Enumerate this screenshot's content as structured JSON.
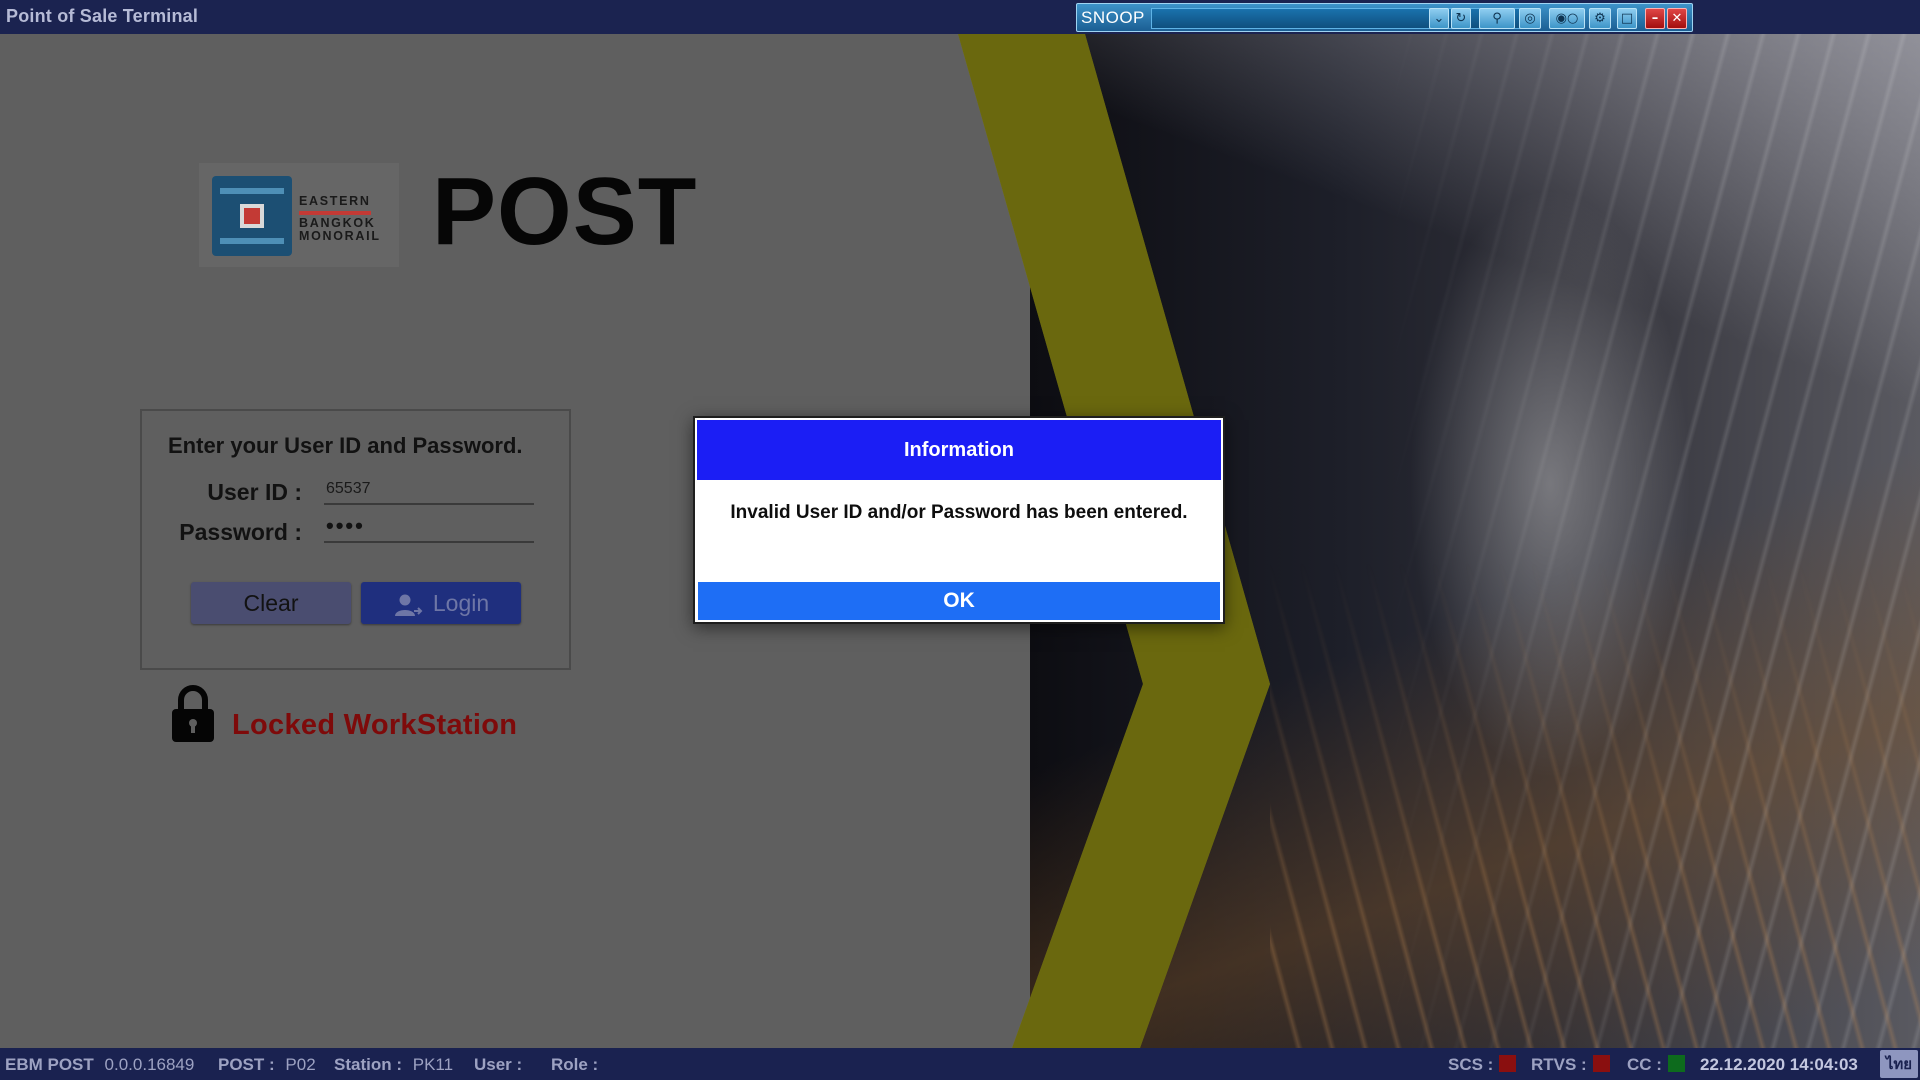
{
  "window": {
    "title": "Point of Sale Terminal"
  },
  "snoop": {
    "label": "SNOOP",
    "buttons": [
      "dropdown",
      "refresh",
      "search",
      "target",
      "toggle",
      "settings",
      "window",
      "minimize",
      "close"
    ]
  },
  "branding": {
    "logo_lines": [
      "EASTERN",
      "BANGKOK",
      "MONORAIL"
    ],
    "title": "POST",
    "colors": {
      "brand_blue": "#1c4f73",
      "brand_red": "#c33a35"
    }
  },
  "login": {
    "prompt": "Enter your User ID and Password.",
    "user_id_label": "User ID :",
    "user_id_value": "65537",
    "password_label": "Password :",
    "password_mask": "••••",
    "clear_label": "Clear",
    "login_label": "Login",
    "locked_label": "Locked WorkStation"
  },
  "dialog": {
    "title": "Information",
    "message": "Invalid User ID and/or Password has been entered.",
    "ok_label": "OK",
    "colors": {
      "header": "#1b1ef5",
      "ok_button": "#1e6ef5"
    }
  },
  "status": {
    "app_name": "EBM POST",
    "version": "0.0.0.16849",
    "post_label": "POST :",
    "post_value": "P02",
    "station_label": "Station :",
    "station_value": "PK11",
    "user_label": "User :",
    "user_value": "",
    "role_label": "Role :",
    "role_value": "",
    "scs_label": "SCS :",
    "scs_color": "#8a0f0f",
    "rtvs_label": "RTVS :",
    "rtvs_color": "#8a0f0f",
    "cc_label": "CC :",
    "cc_color": "#0d6b1d",
    "datetime": "22.12.2020 14:04:03",
    "language": "ไทย"
  }
}
